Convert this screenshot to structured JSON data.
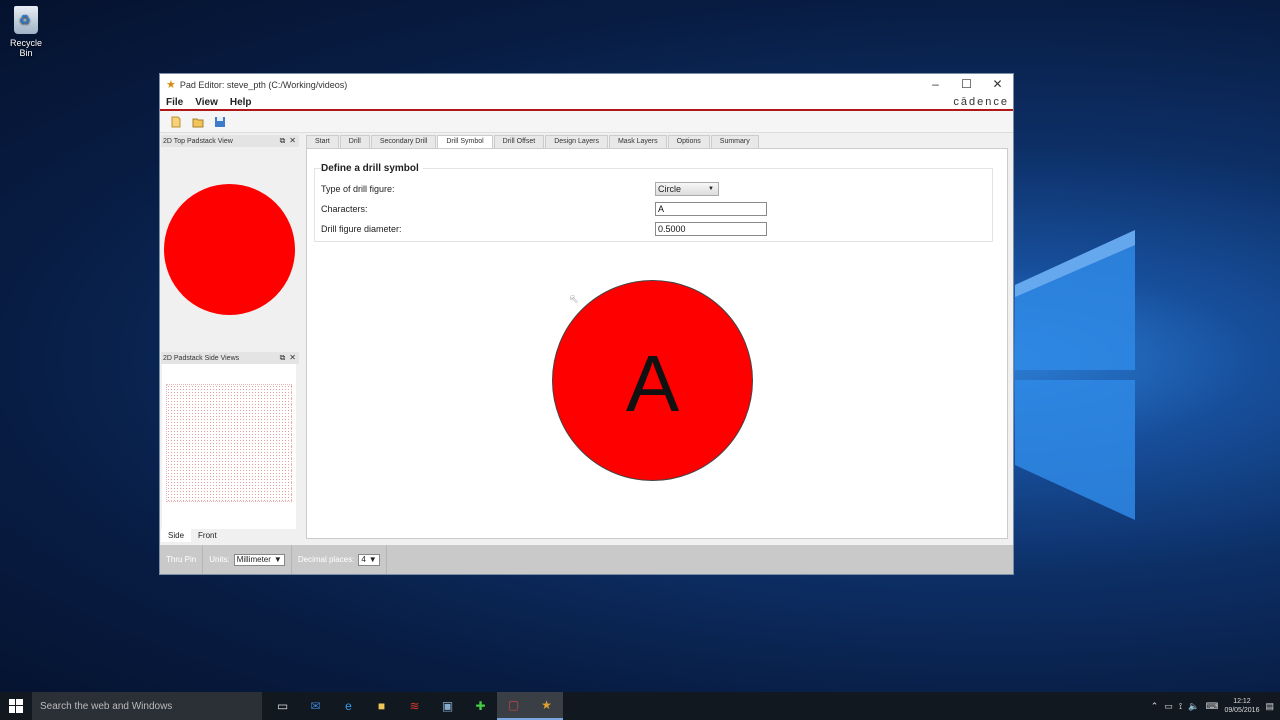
{
  "desktop": {
    "recycle_bin_label": "Recycle Bin"
  },
  "window": {
    "title": "Pad Editor: steve_pth  (C:/Working/videos)",
    "controls": {
      "minimize": "–",
      "maximize": "☐",
      "close": "✕"
    }
  },
  "menu": {
    "items": [
      "File",
      "View",
      "Help"
    ],
    "brand": "cādence"
  },
  "docks": {
    "top_view_title": "2D Top Padstack View",
    "side_view_title": "2D Padstack Side Views",
    "side_tabs": [
      "Side",
      "Front"
    ],
    "dock_icons": {
      "float": "⧉",
      "close": "✕"
    }
  },
  "tabs": [
    "Start",
    "Drill",
    "Secondary Drill",
    "Drill Symbol",
    "Drill Offset",
    "Design Layers",
    "Mask Layers",
    "Options",
    "Summary"
  ],
  "active_tab": "Drill Symbol",
  "drill_symbol": {
    "group_title": "Define a drill symbol",
    "type_label": "Type of drill figure:",
    "type_value": "Circle",
    "characters_label": "Characters:",
    "characters_value": "A",
    "diameter_label": "Drill figure diameter:",
    "diameter_value": "0.5000",
    "preview_character": "A"
  },
  "statusbar": {
    "pin_type": "Thru Pin",
    "units_label": "Units:",
    "units_value": "Millimeter",
    "decimal_label": "Decimal places:",
    "decimal_value": "4"
  },
  "taskbar": {
    "search_placeholder": "Search the web and Windows",
    "time": "12:12",
    "date": "09/05/2016"
  },
  "colors": {
    "pad_fill": "#ff0000",
    "accent_line": "#b01818"
  }
}
